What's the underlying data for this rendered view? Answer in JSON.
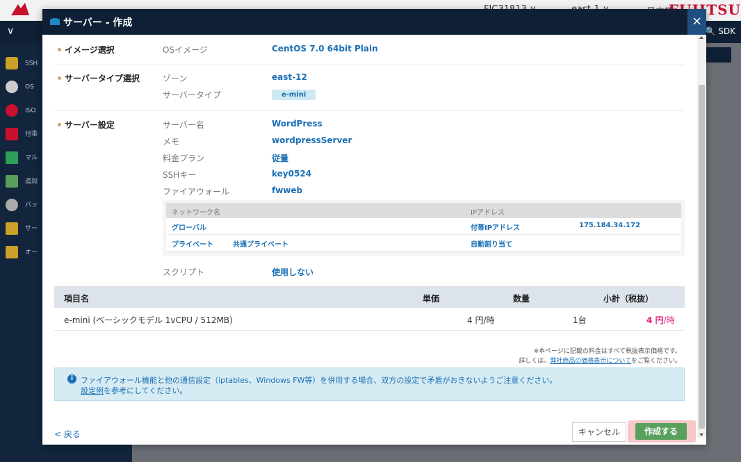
{
  "background": {
    "top_items": [
      "FJC31813 ∨",
      "east-1 ∨",
      "日本語 ∨"
    ],
    "brand": "FUJITSU",
    "sdk_label": "SDK",
    "sidebar_items": [
      "SSH",
      "OS",
      "ISO",
      "付帯",
      "マル",
      "追加",
      "バッ",
      "サー",
      "オー"
    ]
  },
  "modal": {
    "title": "サーバー - 作成",
    "close_icon": "×",
    "sections": {
      "image": {
        "label": "イメージ選択",
        "os_label": "OSイメージ",
        "os_value": "CentOS 7.0 64bit Plain"
      },
      "server_type": {
        "label": "サーバータイプ選択",
        "zone_label": "ゾーン",
        "zone_value": "east-12",
        "type_label": "サーバータイプ",
        "type_value": "e-mini"
      },
      "server_settings": {
        "label": "サーバー設定",
        "fields": [
          {
            "label": "サーバー名",
            "value": "WordPress"
          },
          {
            "label": "メモ",
            "value": "wordpressServer"
          },
          {
            "label": "料金プラン",
            "value": "従量"
          },
          {
            "label": "SSHキー",
            "value": "key0524"
          },
          {
            "label": "ファイアウォール",
            "value": "fwweb"
          }
        ],
        "network": {
          "header_name": "ネットワーク名",
          "header_ip": "IPアドレス",
          "rows": [
            {
              "name": "グローバル",
              "name2": "",
              "ip_type": "付帯IPアドレス",
              "ip": "175.184.34.172"
            },
            {
              "name": "プライベート",
              "name2": "共通プライベート",
              "ip_type": "自動割り当て",
              "ip": ""
            }
          ]
        },
        "script_label": "スクリプト",
        "script_value": "使用しない"
      }
    },
    "pricing": {
      "headers": {
        "item": "項目名",
        "unit": "単価",
        "qty": "数量",
        "subtotal": "小計（税抜）"
      },
      "rows": [
        {
          "item": "e-mini (ベーシックモデル 1vCPU / 512MB)",
          "unit": "4 円/時",
          "qty": "1台",
          "subtotal_num": "4 円",
          "subtotal_unit": "/時"
        }
      ],
      "note_line1": "※本ページに記載の料金はすべて税抜表示価格です。",
      "note_line2_pre": "詳しくは、",
      "note_link": "弊社商品の価格表示について",
      "note_line2_post": "をご覧ください。"
    },
    "info": {
      "icon": "i",
      "line1": "ファイアウォール機能と他の通信設定（iptables、Windows FW等）を併用する場合、双方の設定で矛盾がおきないようご注意ください。",
      "line2_link": "設定例",
      "line2_post": "を参考にしてください。"
    },
    "footer": {
      "back": "< 戻る",
      "cancel": "キャンセル",
      "create": "作成する"
    }
  },
  "colors": {
    "header_bg": "#0f2036",
    "link": "#1a6fb5",
    "price": "#e21d7a",
    "create_btn": "#5aa05d"
  }
}
